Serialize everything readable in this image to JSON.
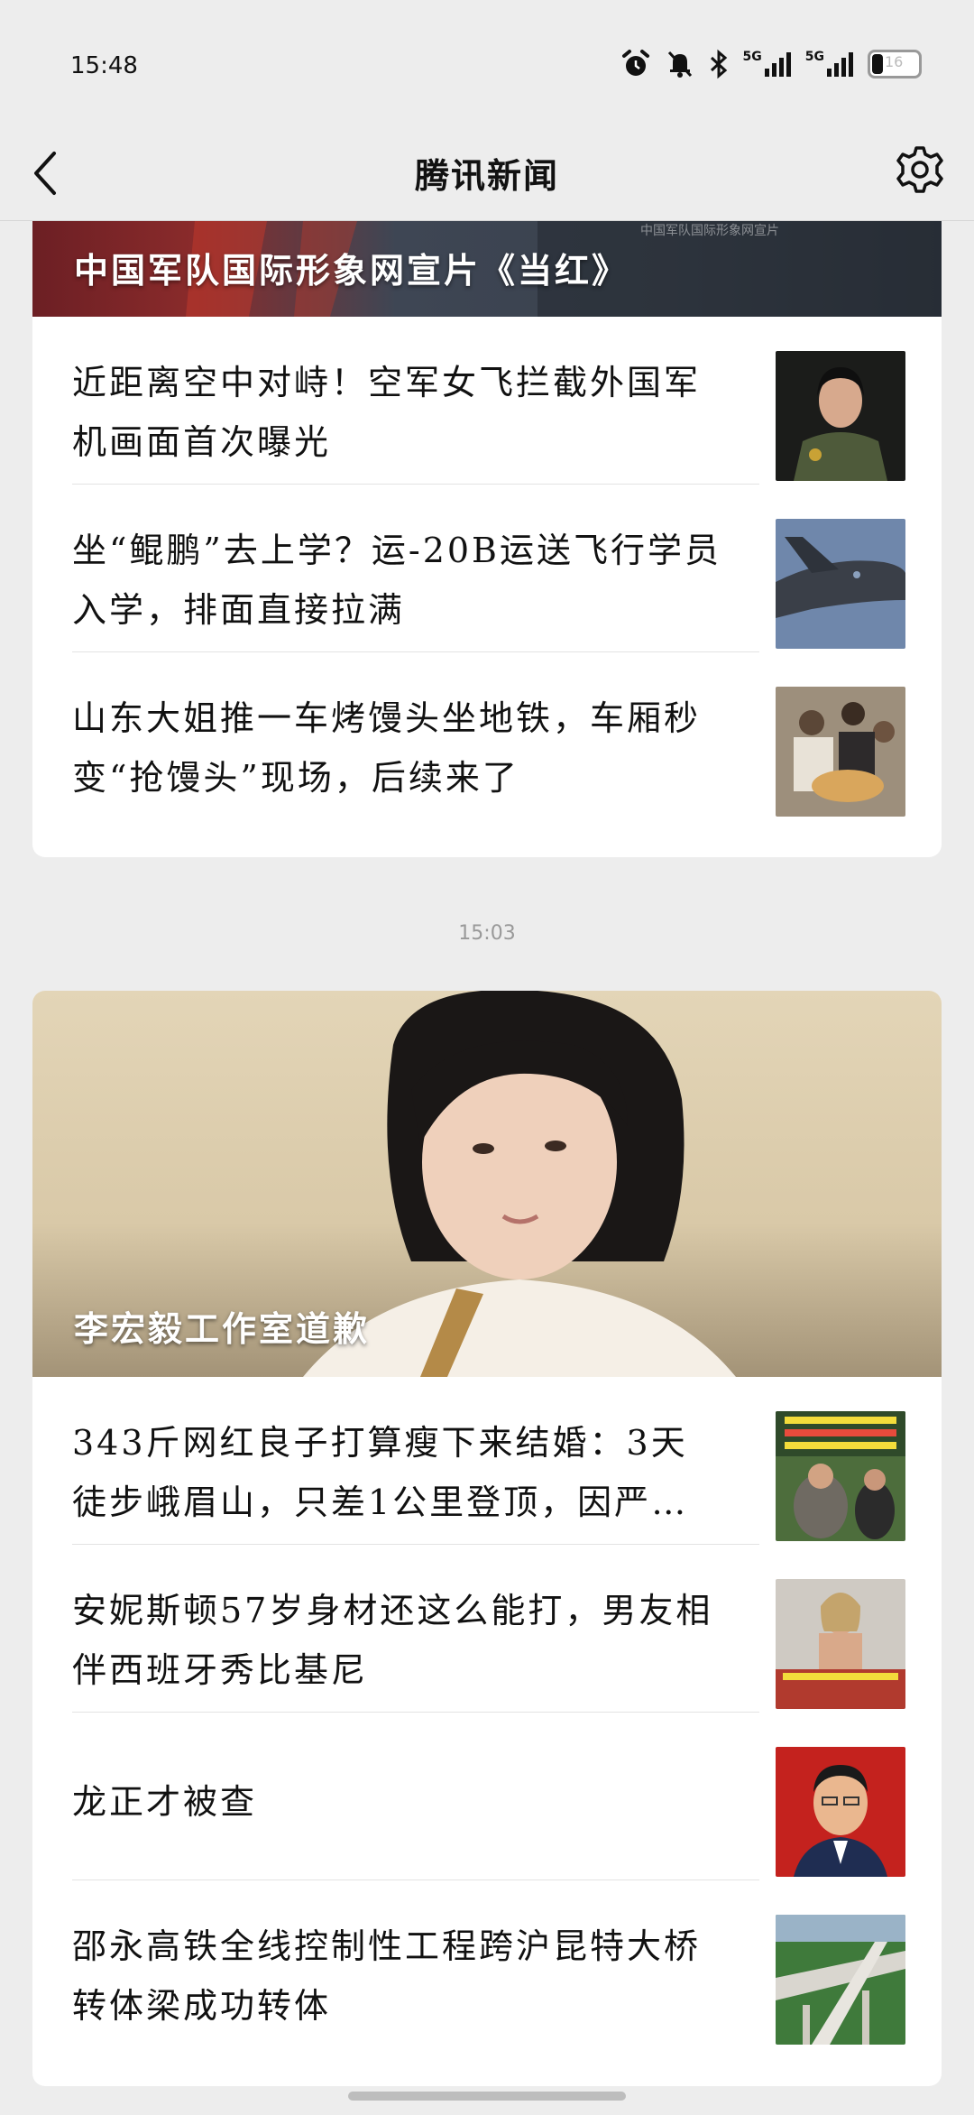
{
  "status_bar": {
    "time": "15:48",
    "signal1_label": "5G",
    "signal2_label": "5G",
    "battery": "16",
    "icons": [
      "alarm-icon",
      "bell-muted-icon",
      "bluetooth-icon",
      "signal-icon",
      "signal-icon",
      "battery-icon"
    ]
  },
  "nav": {
    "title": "腾讯新闻",
    "back_icon": "chevron-left-icon",
    "settings_icon": "gear-icon"
  },
  "group1": {
    "banner_title": "中国军队国际形象网宣片《当红》",
    "banner_watermark": "中国军队国际形象网宣片",
    "items": [
      {
        "title": "近距离空中对峙！空军女飞拦截外国军机画面首次曝光",
        "thumb": "female-pilot-photo"
      },
      {
        "title": "坐“鲲鹏”去上学？运-20B运送飞行学员入学，排面直接拉满",
        "thumb": "transport-plane-photo"
      },
      {
        "title": "山东大姐推一车烤馒头坐地铁，车厢秒变“抢馒头”现场，后续来了",
        "thumb": "subway-crowd-photo"
      }
    ]
  },
  "timestamp": "15:03",
  "group2": {
    "banner_title": "李宏毅工作室道歉",
    "items": [
      {
        "title": "343斤网红良子打算瘦下来结婚：3天徒步峨眉山，只差1公里登顶，因严重…",
        "thumb": "hiking-photo"
      },
      {
        "title": "安妮斯顿57岁身材还这么能打，男友相伴西班牙秀比基尼",
        "thumb": "bikini-photo"
      },
      {
        "title": "龙正才被查",
        "thumb": "official-portrait-photo"
      },
      {
        "title": "邵永高铁全线控制性工程跨沪昆特大桥转体梁成功转体",
        "thumb": "railway-bridge-photo"
      }
    ]
  }
}
